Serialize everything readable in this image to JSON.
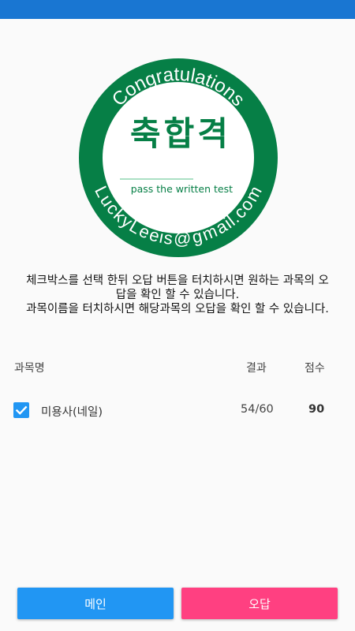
{
  "colors": {
    "status_bar": "#1976d2",
    "seal_green": "#067f46",
    "primary": "#2196f3",
    "accent": "#ff4081"
  },
  "seal": {
    "top_arc_text": "Congratulations",
    "center_text": "축합격",
    "subtitle": "pass the written test",
    "bottom_arc_text": "LuckyLeeis@gmail.com"
  },
  "instructions": {
    "line1": "체크박스를 선택 한뒤 오답 버튼을 터치하시면 원하는 과목의 오답을 확인 할 수 있습니다.",
    "line2": "과목이름을 터치하시면 해당과목의 오답을 확인 할 수 있습니다."
  },
  "table": {
    "headers": {
      "subject": "과목명",
      "result": "결과",
      "score": "점수"
    },
    "rows": [
      {
        "checked": true,
        "subject": "미용사(네일)",
        "result": "54/60",
        "score": "90"
      }
    ]
  },
  "buttons": {
    "main": "메인",
    "wrong": "오답"
  }
}
